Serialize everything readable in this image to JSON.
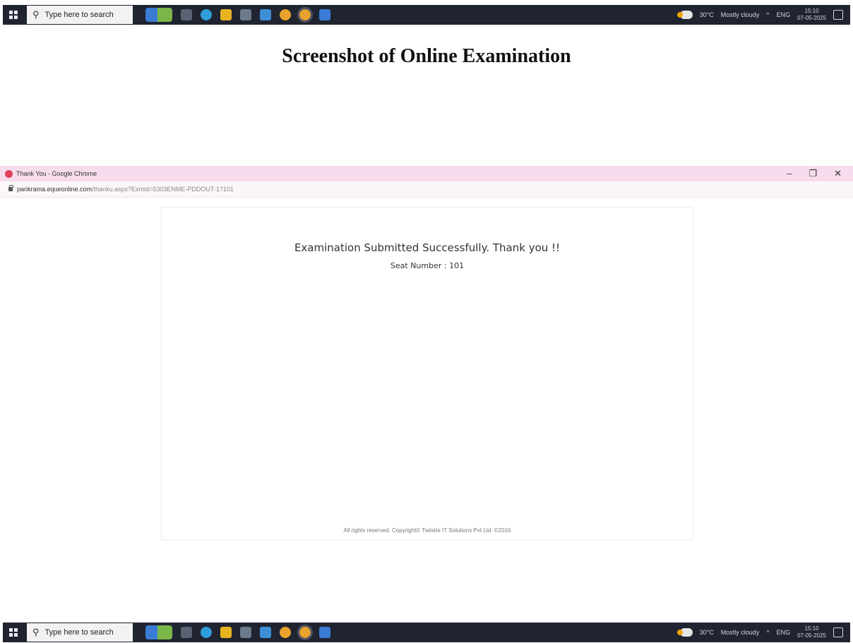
{
  "taskbar": {
    "search_placeholder": "Type here to search",
    "weather_temp": "30°C",
    "weather_text": "Mostly cloudy",
    "language": "ENG",
    "time": "15:10",
    "date": "07-05-2025"
  },
  "heading": "Screenshot of Online Examination",
  "browser": {
    "title": "Thank You - Google Chrome",
    "url_host": "parikrama.equeonline.com",
    "url_path": "/thanku.aspx?Exmid=5303ENME-PDDOUT-1?101",
    "controls": {
      "minimize": "–",
      "restore": "❐",
      "close": "✕"
    }
  },
  "page": {
    "message": "Examination Submitted Successfully. Thank you !!",
    "seat_label": "Seat Number : 101",
    "footer": "All rights reserved. Copyright© Twinkle IT Solutions Pvt Ltd. ©2016"
  },
  "colors": {
    "taskbar_bg": "#1f2430",
    "titlebar_bg": "#f6dcec",
    "chrome_red": "#e0405a"
  }
}
